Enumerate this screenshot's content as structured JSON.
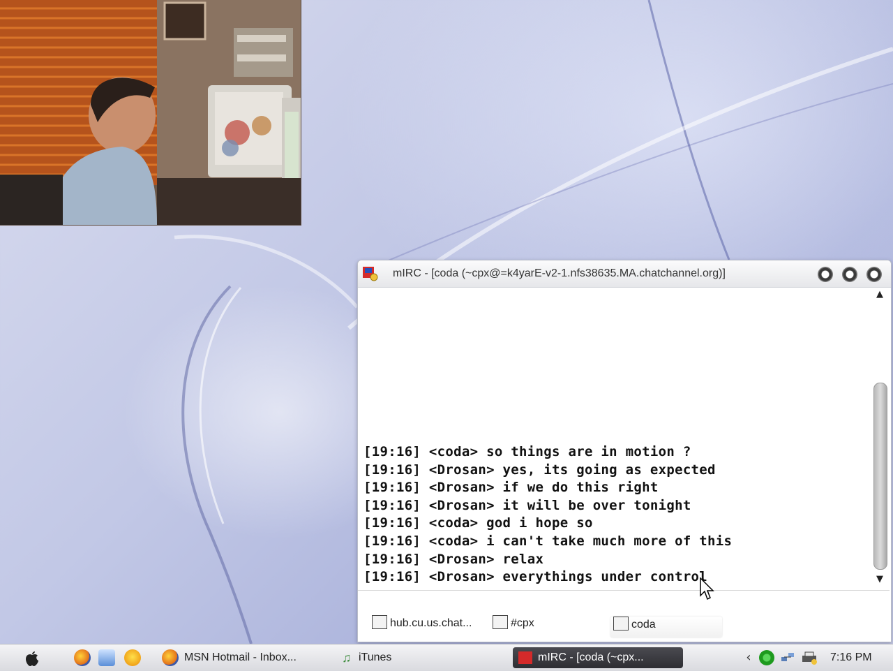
{
  "mirc": {
    "title": "mIRC - [coda (~cpx@=k4yarE-v2-1.nfs38635.MA.chatchannel.org)]",
    "messages": [
      "[19:16] <coda> so things are in motion ?",
      "[19:16] <Drosan> yes, its going as expected",
      "[19:16] <Drosan> if we do this right",
      "[19:16] <Drosan> it will be over tonight",
      "[19:16] <coda> god i hope so",
      "[19:16] <coda> i can't take much more of this",
      "[19:16] <Drosan> relax",
      "[19:16] <Drosan> everythings under control"
    ],
    "switchbar": {
      "server": "hub.cu.us.chat...",
      "channel": "#cpx",
      "query": "coda"
    }
  },
  "taskbar": {
    "tasks": [
      {
        "label": "MSN Hotmail - Inbox..."
      },
      {
        "label": "iTunes"
      },
      {
        "label": "mIRC - [coda (~cpx..."
      }
    ],
    "clock": "7:16 PM"
  },
  "colors": {
    "wallpaper": "#c2c8e6",
    "active_task": "#2e2e33",
    "chat_text": "#111111"
  }
}
